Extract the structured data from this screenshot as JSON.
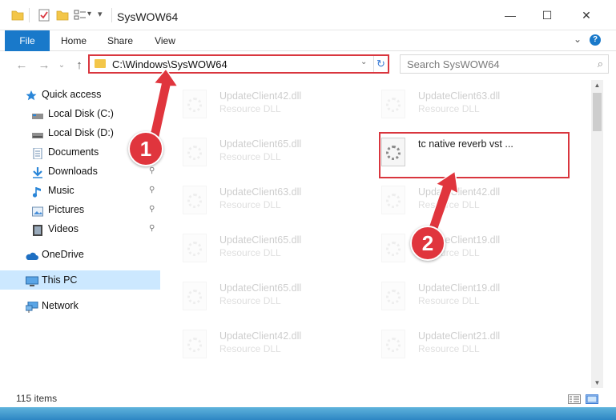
{
  "window": {
    "title": "SysWOW64",
    "minimize": "—",
    "maximize": "☐",
    "close": "✕"
  },
  "ribbon": {
    "tabs": [
      "File",
      "Home",
      "Share",
      "View"
    ],
    "expand": "⌄",
    "help": "?"
  },
  "address": {
    "path": "C:\\Windows\\SysWOW64",
    "dropdown": "⌄",
    "refresh": "↻"
  },
  "search": {
    "placeholder": "Search SysWOW64",
    "icon": "⌕"
  },
  "nav_buttons": {
    "back": "←",
    "forward": "→",
    "recent": "⌄",
    "up": "↑"
  },
  "sidebar": {
    "items": [
      {
        "label": "Quick access",
        "icon": "star-icon"
      },
      {
        "label": "Local Disk (C:)",
        "icon": "drive-icon",
        "pinned": true
      },
      {
        "label": "Local Disk (D:)",
        "icon": "drive-icon",
        "pinned": true
      },
      {
        "label": "Documents",
        "icon": "document-icon",
        "pinned": true
      },
      {
        "label": "Downloads",
        "icon": "download-icon",
        "pinned": true
      },
      {
        "label": "Music",
        "icon": "music-icon",
        "pinned": true
      },
      {
        "label": "Pictures",
        "icon": "picture-icon",
        "pinned": true
      },
      {
        "label": "Videos",
        "icon": "video-icon",
        "pinned": true
      },
      {
        "label": "OneDrive",
        "icon": "cloud-icon"
      },
      {
        "label": "This PC",
        "icon": "computer-icon",
        "selected": true
      },
      {
        "label": "Network",
        "icon": "network-icon"
      }
    ],
    "pin_glyph": "📌"
  },
  "files": [
    {
      "name": "UpdateClient42.dll",
      "type": "Resource DLL"
    },
    {
      "name": "UpdateClient63.dll",
      "type": "Resource DLL"
    },
    {
      "name": "UpdateClient65.dll",
      "type": "Resource DLL"
    },
    {
      "name": "tc native reverb vst ...",
      "type": "",
      "highlighted": true
    },
    {
      "name": "UpdateClient63.dll",
      "type": "Resource DLL"
    },
    {
      "name": "UpdateClient42.dll",
      "type": "Resource DLL"
    },
    {
      "name": "UpdateClient65.dll",
      "type": "Resource DLL"
    },
    {
      "name": "UpdateClient19.dll",
      "type": "Resource DLL"
    },
    {
      "name": "UpdateClient65.dll",
      "type": "Resource DLL"
    },
    {
      "name": "UpdateClient19.dll",
      "type": "Resource DLL"
    },
    {
      "name": "UpdateClient42.dll",
      "type": "Resource DLL"
    },
    {
      "name": "UpdateClient21.dll",
      "type": "Resource DLL"
    }
  ],
  "status": {
    "count": "115 items"
  },
  "annotations": {
    "step1": "1",
    "step2": "2"
  },
  "colors": {
    "accent": "#1979ca",
    "highlight_red": "#d9363e",
    "selected_bg": "#cce8ff",
    "folder": "#f3c649"
  }
}
